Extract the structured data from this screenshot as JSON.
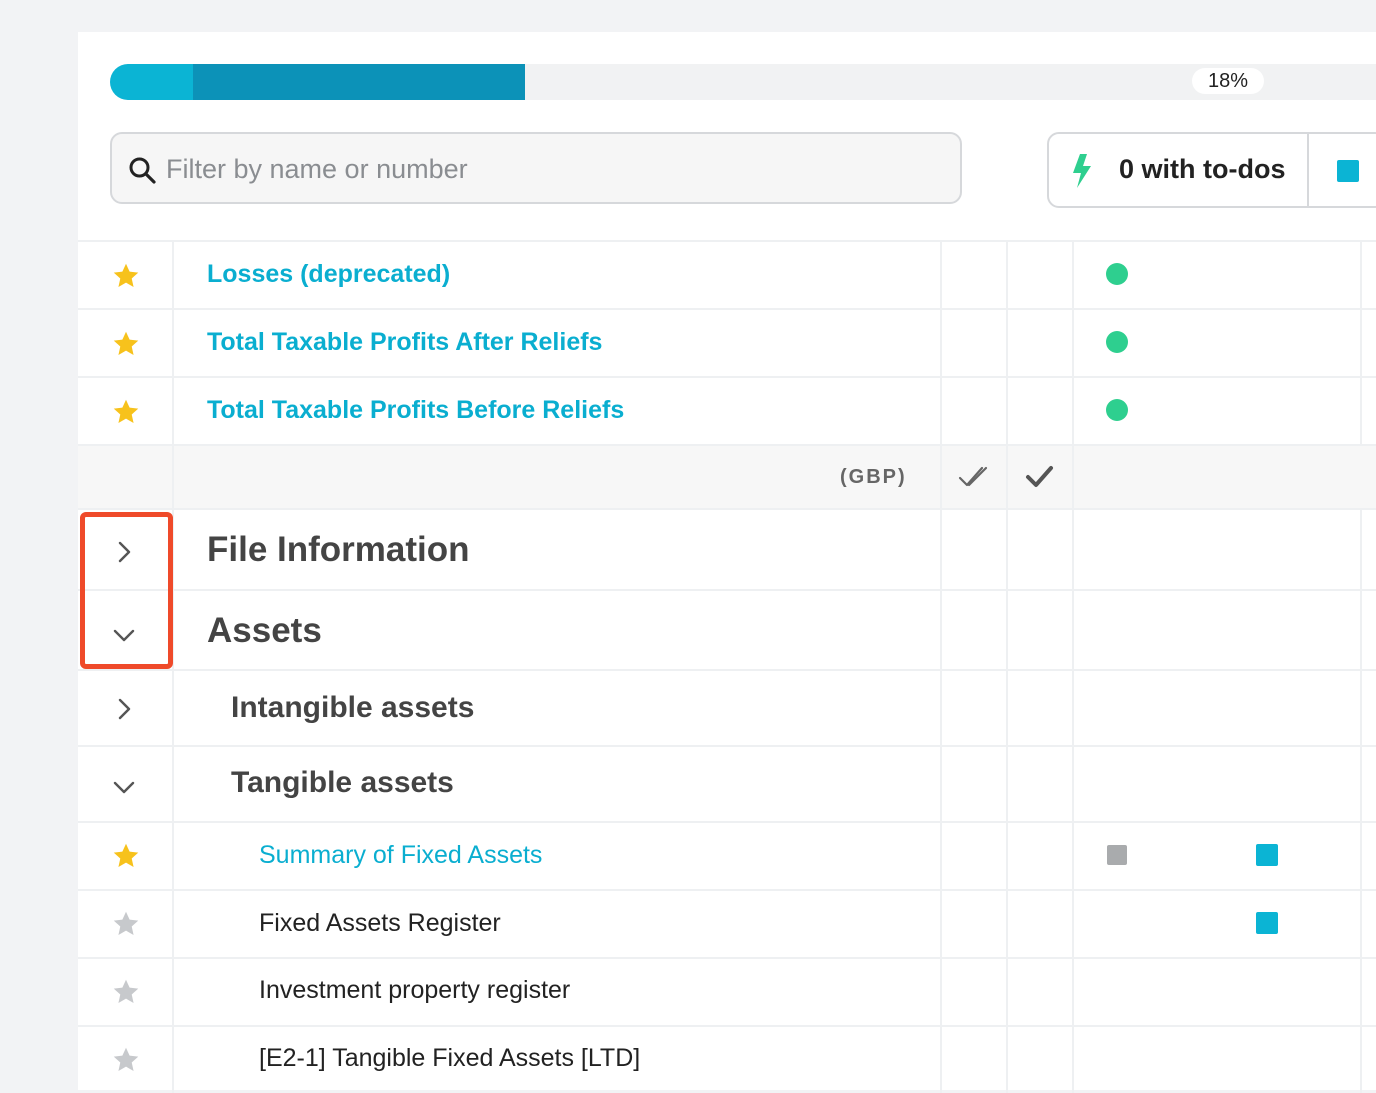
{
  "progress": {
    "label": "18%",
    "percent": 18
  },
  "search": {
    "placeholder": "Filter by name or number",
    "value": ""
  },
  "filters": {
    "todo_label": "0 with to-dos",
    "todo_icon": "bolt-icon",
    "accent": "#0bb4d4"
  },
  "table": {
    "header": {
      "currency": "(GBP)",
      "col_icons": [
        "double-check-icon",
        "check-icon"
      ]
    },
    "rows": [
      {
        "label": "Losses (deprecated)",
        "icon": "star-icon",
        "starred": true,
        "status": "green-dot"
      },
      {
        "label": "Total Taxable Profits After Reliefs",
        "icon": "star-icon",
        "starred": true,
        "status": "green-dot"
      },
      {
        "label": "Total Taxable Profits Before Reliefs",
        "icon": "star-icon",
        "starred": true,
        "status": "green-dot"
      },
      {
        "label": "File Information",
        "icon": "chevron-right-icon",
        "expanded": false
      },
      {
        "label": "Assets",
        "icon": "chevron-down-icon",
        "expanded": true
      },
      {
        "label": "Intangible assets",
        "icon": "chevron-right-icon",
        "expanded": false
      },
      {
        "label": "Tangible assets",
        "icon": "chevron-down-icon",
        "expanded": true
      },
      {
        "label": "Summary of Fixed Assets",
        "icon": "star-icon",
        "starred": true,
        "status": "grey-square",
        "flag": "blue-square"
      },
      {
        "label": "Fixed Assets Register",
        "icon": "star-icon",
        "starred": false,
        "flag": "blue-square"
      },
      {
        "label": "Investment property register",
        "icon": "star-icon",
        "starred": false
      },
      {
        "label": "[E2-1] Tangible Fixed Assets [LTD]",
        "icon": "star-icon",
        "starred": false
      }
    ]
  },
  "colors": {
    "green": "#2ecf8f",
    "blue": "#0bb4d4",
    "link": "#0aaed0",
    "star_on": "#f7c21c",
    "star_off": "#c7c9cc",
    "highlight": "#ef4a2a"
  }
}
